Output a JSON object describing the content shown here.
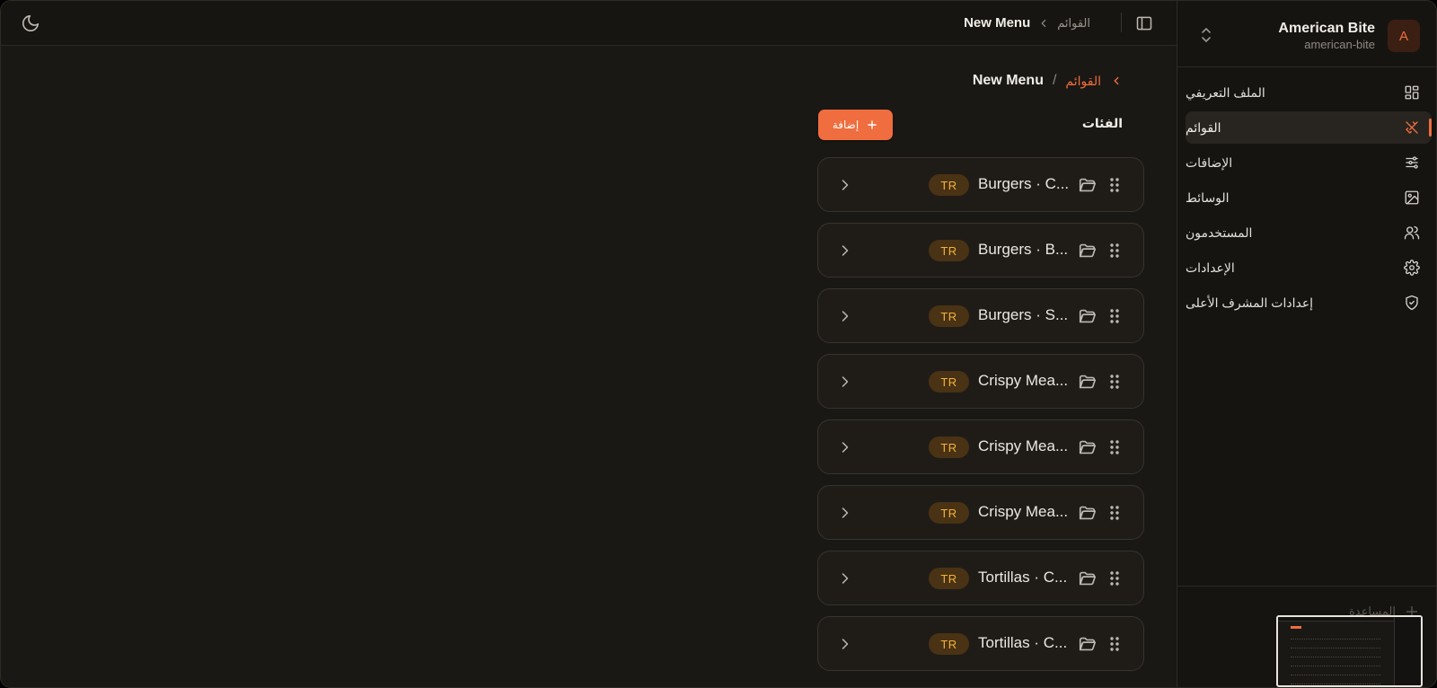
{
  "topbar": {
    "breadcrumb_current": "New Menu",
    "breadcrumb_link": "القوائم"
  },
  "page": {
    "breadcrumb_current": "New Menu",
    "breadcrumb_separator": "/",
    "breadcrumb_link": "القوائم",
    "section_title": "الفئات",
    "add_button_label": "إضافة"
  },
  "categories": [
    {
      "name": "Burgers · C...",
      "badge": "TR"
    },
    {
      "name": "Burgers · B...",
      "badge": "TR"
    },
    {
      "name": "Burgers · S...",
      "badge": "TR"
    },
    {
      "name": "Crispy Mea...",
      "badge": "TR"
    },
    {
      "name": "Crispy Mea...",
      "badge": "TR"
    },
    {
      "name": "Crispy Mea...",
      "badge": "TR"
    },
    {
      "name": "Tortillas · C...",
      "badge": "TR"
    },
    {
      "name": "Tortillas · C...",
      "badge": "TR"
    }
  ],
  "sidebar": {
    "org_name": "American Bite",
    "org_slug": "american-bite",
    "org_initial": "A",
    "items": [
      {
        "label": "الملف التعريفي",
        "icon": "dashboard-grid-icon"
      },
      {
        "label": "القوائم",
        "icon": "utensils-icon",
        "active": true
      },
      {
        "label": "الإضافات",
        "icon": "sliders-icon"
      },
      {
        "label": "الوسائط",
        "icon": "image-icon"
      },
      {
        "label": "المستخدمون",
        "icon": "users-icon"
      },
      {
        "label": "الإعدادات",
        "icon": "gear-icon"
      },
      {
        "label": "إعدادات المشرف الأعلى",
        "icon": "shield-check-icon"
      }
    ],
    "bottom_label": "المساعدة"
  },
  "colors": {
    "accent": "#ef6d3e",
    "badge_bg": "#4a3214",
    "badge_text": "#f2b33a",
    "background": "#1a1814"
  }
}
